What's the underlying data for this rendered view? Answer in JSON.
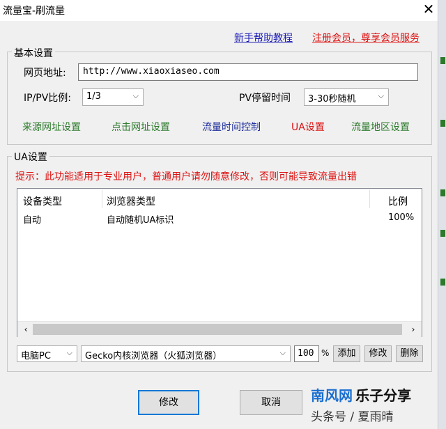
{
  "window": {
    "title": "流量宝-刷流量"
  },
  "links": {
    "help": "新手帮助教程",
    "register": "注册会员，尊享会员服务"
  },
  "basic": {
    "legend": "基本设置",
    "url_label": "网页地址:",
    "url_value": "http://www.xiaoxiaseo.com",
    "ratio_label": "IP/PV比例:",
    "ratio_value": "1/3",
    "dwell_label": "PV停留时间",
    "dwell_value": "3-30秒随机",
    "nav": [
      "来源网址设置",
      "点击网址设置",
      "流量时间控制",
      "UA设置",
      "流量地区设置"
    ]
  },
  "ua": {
    "legend": "UA设置",
    "warning": "提示：此功能适用于专业用户，普通用户请勿随意修改，否则可能导致流量出错",
    "columns": [
      "设备类型",
      "浏览器类型",
      "比例"
    ],
    "rows": [
      {
        "device": "自动",
        "browser": "自动随机UA标识",
        "ratio": "100%"
      }
    ],
    "device_select": "电脑PC",
    "browser_select": "Gecko内核浏览器（火狐浏览器）",
    "percent_value": "100",
    "percent_sign": "%",
    "add_label": "添加",
    "edit_label": "修改",
    "delete_label": "删除"
  },
  "footer": {
    "ok_label": "修改",
    "cancel_label": "取消"
  },
  "watermark": {
    "brand_a": "南风网",
    "brand_b": "乐子分享",
    "line2": "头条号 / 夏雨晴"
  },
  "colors": {
    "link_blue": "#1a1ab5",
    "red": "#dd1111",
    "green": "#2d7a2d",
    "navy": "#1a2a9a",
    "brand_blue": "#1a6fd0",
    "brand_dark": "#111111"
  },
  "icons": {
    "close": "close-icon",
    "dropdown": "chevron-down-icon",
    "scroll_left": "chevron-left-icon",
    "scroll_right": "chevron-right-icon"
  }
}
